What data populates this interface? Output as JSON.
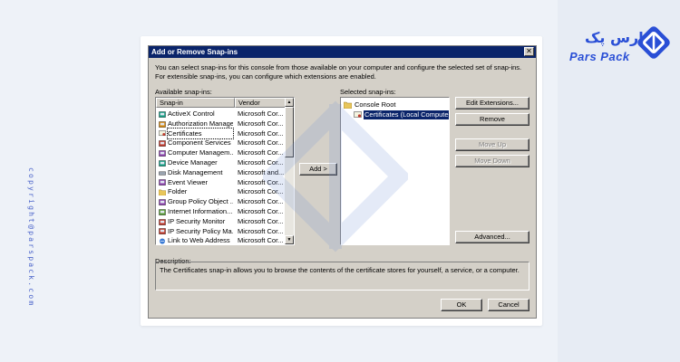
{
  "brand": {
    "name_fa": "پارس پک",
    "name_en": "Pars Pack",
    "copyright": "copyright@parspack.com",
    "accent": "#2a4fd6"
  },
  "dialog": {
    "title": "Add or Remove Snap-ins",
    "close_label": "✕",
    "intro": "You can select snap-ins for this console from those available on your computer and configure the selected set of snap-ins. For extensible snap-ins, you can configure which extensions are enabled.",
    "available_label": "Available snap-ins:",
    "selected_label": "Selected snap-ins:",
    "columns": {
      "snapin": "Snap-in",
      "vendor": "Vendor"
    },
    "available_items": [
      {
        "name": "ActiveX Control",
        "vendor": "Microsoft Cor...",
        "icon": "activex-icon"
      },
      {
        "name": "Authorization Manager",
        "vendor": "Microsoft Cor...",
        "icon": "authorization-icon"
      },
      {
        "name": "Certificates",
        "vendor": "Microsoft Cor...",
        "icon": "certificate-icon",
        "selected": true
      },
      {
        "name": "Component Services",
        "vendor": "Microsoft Cor...",
        "icon": "component-services-icon"
      },
      {
        "name": "Computer Managem...",
        "vendor": "Microsoft Cor...",
        "icon": "computer-management-icon"
      },
      {
        "name": "Device Manager",
        "vendor": "Microsoft Cor...",
        "icon": "device-manager-icon"
      },
      {
        "name": "Disk Management",
        "vendor": "Microsoft and...",
        "icon": "disk-icon"
      },
      {
        "name": "Event Viewer",
        "vendor": "Microsoft Cor...",
        "icon": "event-viewer-icon"
      },
      {
        "name": "Folder",
        "vendor": "Microsoft Cor...",
        "icon": "folder-icon"
      },
      {
        "name": "Group Policy Object ...",
        "vendor": "Microsoft Cor...",
        "icon": "group-policy-icon"
      },
      {
        "name": "Internet Information...",
        "vendor": "Microsoft Cor...",
        "icon": "iis-icon"
      },
      {
        "name": "IP Security Monitor",
        "vendor": "Microsoft Cor...",
        "icon": "ip-security-icon"
      },
      {
        "name": "IP Security Policy Ma...",
        "vendor": "Microsoft Cor...",
        "icon": "ip-security-policy-icon"
      },
      {
        "name": "Link to Web Address",
        "vendor": "Microsoft Cor...",
        "icon": "link-icon"
      }
    ],
    "add_button": "Add >",
    "selected_tree": [
      {
        "name": "Console Root",
        "icon": "folder-icon",
        "level": 0
      },
      {
        "name": "Certificates (Local Computer)",
        "icon": "certificate-icon",
        "level": 1,
        "selected": true
      }
    ],
    "buttons": {
      "edit_extensions": "Edit Extensions...",
      "remove": "Remove",
      "move_up": "Move Up",
      "move_down": "Move Down",
      "advanced": "Advanced...",
      "ok": "OK",
      "cancel": "Cancel"
    },
    "description_label": "Description:",
    "description": "The Certificates snap-in allows you to browse the contents of the certificate stores for yourself, a service, or a computer."
  }
}
